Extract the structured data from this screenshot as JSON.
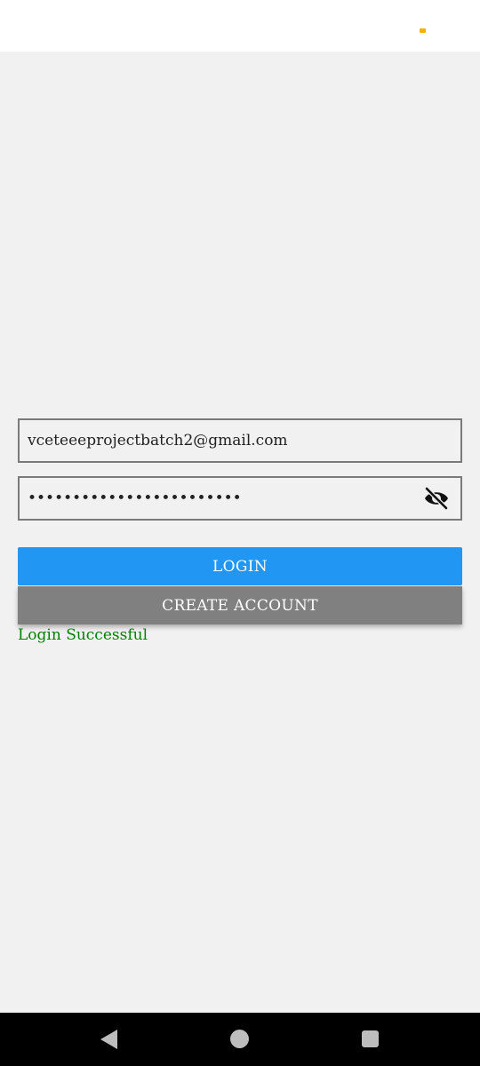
{
  "login_form": {
    "email_value": "vceteeeprojectbatch2@gmail.com",
    "password_value": "vceteeeprojectbatch2@123",
    "login_label": "LOGIN",
    "create_account_label": "CREATE ACCOUNT",
    "status_message": "Login Successful"
  },
  "icons": {
    "password_toggle": "eye-off-icon",
    "nav_back": "back-triangle-icon",
    "nav_home": "home-circle-icon",
    "nav_recents": "recents-square-icon"
  },
  "colors": {
    "login_button": "#2196f3",
    "create_account_button": "#808080",
    "status_success": "#008000",
    "background": "#f1f1f1"
  }
}
